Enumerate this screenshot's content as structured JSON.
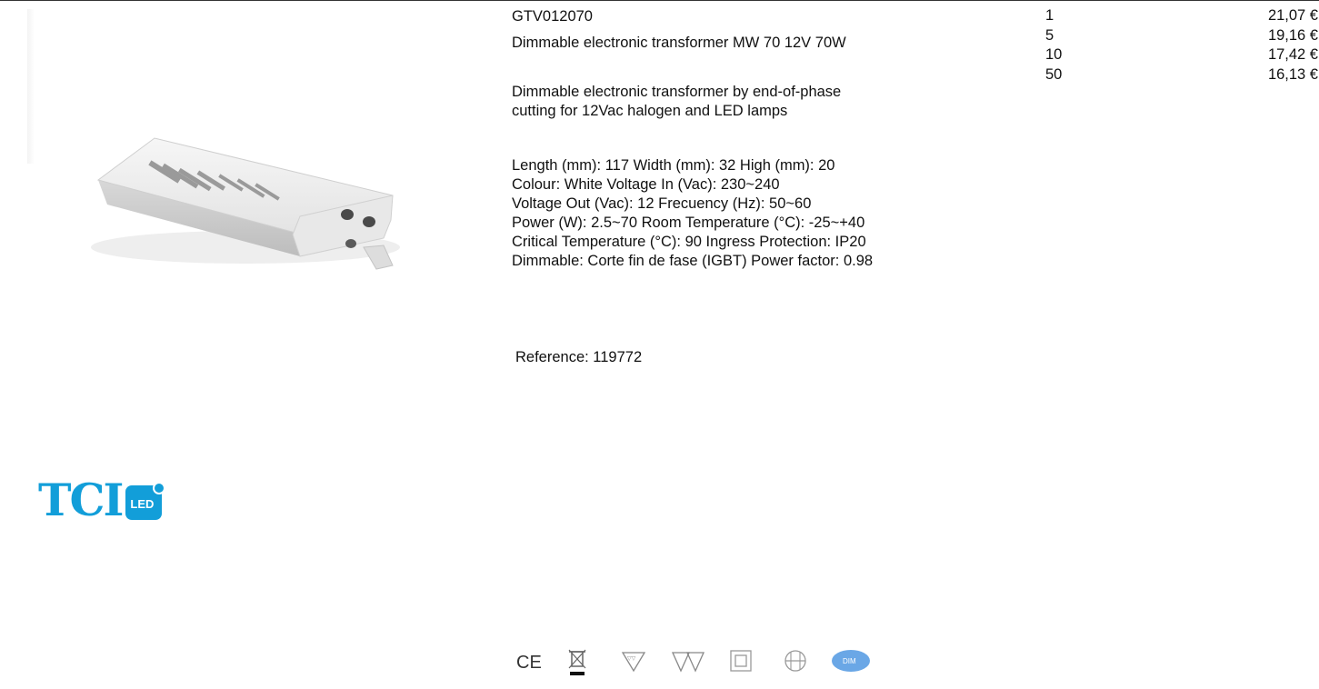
{
  "product": {
    "code": "GTV012070",
    "name": "Dimmable electronic transformer MW 70 12V 70W",
    "description": [
      "Dimmable electronic transformer by end-of-phase",
      "cutting for 12Vac halogen and LED lamps"
    ],
    "specs": [
      "Length (mm): 117 Width (mm): 32 High (mm): 20",
      "Colour: White Voltage In (Vac): 230~240",
      "Voltage Out (Vac): 12 Frecuency (Hz): 50~60",
      "Power (W): 2.5~70 Room Temperature (°C): -25~+40",
      "Critical Temperature (°C): 90 Ingress Protection: IP20",
      "Dimmable: Corte fin de fase (IGBT) Power factor: 0.98"
    ],
    "reference": "Reference: 119772"
  },
  "pricing": [
    {
      "qty": "1",
      "price": "21,07 €"
    },
    {
      "qty": "5",
      "price": "19,16 €"
    },
    {
      "qty": "10",
      "price": "17,42 €"
    },
    {
      "qty": "50",
      "price": "16,13 €"
    }
  ],
  "brand": {
    "name": "TCI",
    "badge": "LED",
    "color": "#129ed9"
  },
  "certifications": [
    {
      "icon": "ce-mark-icon",
      "label": "CE"
    },
    {
      "icon": "weee-bin-icon",
      "label": ""
    },
    {
      "icon": "furniture-mount-icon",
      "label": ""
    },
    {
      "icon": "double-furniture-mount-icon",
      "label": ""
    },
    {
      "icon": "class-ii-insulation-icon",
      "label": ""
    },
    {
      "icon": "independent-control-gear-icon",
      "label": ""
    },
    {
      "icon": "dimmable-badge-icon",
      "label": "DIM"
    }
  ]
}
